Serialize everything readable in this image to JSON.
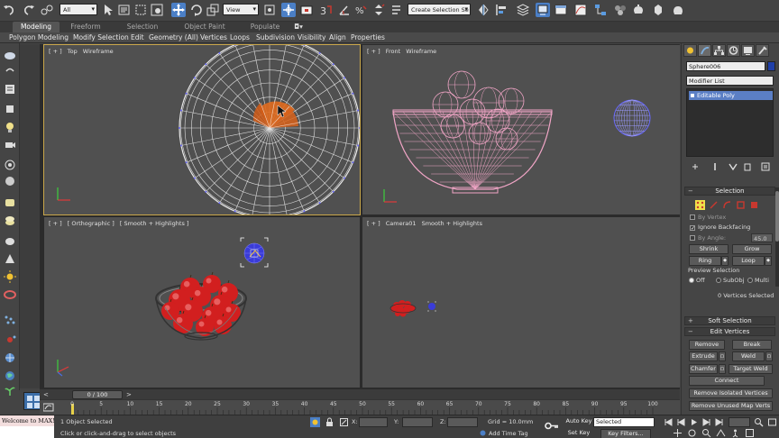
{
  "toolbar": {
    "selection_filter": "All",
    "reference_coord": "View",
    "named_selection_placeholder": "Create Selection Se",
    "snap_angle_label": "3",
    "colors": {
      "active": "#4b7fc6",
      "accent_red": "#c8382f"
    }
  },
  "ribbon": {
    "tabs": [
      "Modeling",
      "Freeform",
      "Selection",
      "Object Paint",
      "Populate"
    ],
    "active_tab": "Modeling",
    "items": [
      "Polygon Modeling",
      "Modify Selection",
      "Edit",
      "Geometry (All)",
      "Vertices",
      "Loops",
      "Subdivision",
      "Visibility",
      "Align",
      "Properties"
    ]
  },
  "viewports": {
    "top": {
      "name": "Top",
      "shading": "Wireframe"
    },
    "front": {
      "name": "Front",
      "shading": "Wireframe"
    },
    "ortho": {
      "name": "[ Orthographic ]",
      "shading": "[ Smooth + Highlights ]"
    },
    "camera": {
      "name": "Camera01",
      "shading": "Smooth + Highlights"
    },
    "plus": "[ + ]"
  },
  "command_panel": {
    "object_name": "Sphere006",
    "modifier_list": "Modifier List",
    "stack": [
      "Editable Poly"
    ],
    "selection_title": "Selection",
    "by_vertex": "By Vertex",
    "ignore_backfacing": "Ignore Backfacing",
    "by_angle": "By Angle:",
    "by_angle_value": "45.0",
    "shrink": "Shrink",
    "grow": "Grow",
    "ring": "Ring",
    "loop": "Loop",
    "preview_selection": "Preview Selection",
    "preview_off": "Off",
    "preview_subobj": "SubObj",
    "preview_multi": "Multi",
    "vertices_selected": "0 Vertices Selected",
    "soft_selection": "Soft Selection",
    "edit_vertices": "Edit Vertices",
    "remove": "Remove",
    "break": "Break",
    "extrude": "Extrude",
    "weld": "Weld",
    "chamfer": "Chamfer",
    "target_weld": "Target Weld",
    "connect": "Connect",
    "remove_isolated": "Remove Isolated Vertices",
    "remove_unused": "Remove Unused Map Verts"
  },
  "timeline": {
    "slider_label": "0 / 100",
    "ticks": [
      "0",
      "5",
      "10",
      "15",
      "20",
      "25",
      "30",
      "35",
      "40",
      "45",
      "50",
      "55",
      "60",
      "65",
      "70",
      "75",
      "80",
      "85",
      "90",
      "95",
      "100"
    ]
  },
  "status": {
    "maxscript_line1": "Welcome to MAX!",
    "maxscript_line2": "",
    "objects_selected": "1 Object Selected",
    "prompt": "Click or click-and-drag to select objects",
    "x_label": "X:",
    "y_label": "Y:",
    "z_label": "Z:",
    "grid": "Grid = 10.0mm",
    "add_time_tag": "Add Time Tag",
    "auto_key": "Auto Key",
    "set_key": "Set Key",
    "selected": "Selected",
    "key_filters": "Key Filters..."
  }
}
